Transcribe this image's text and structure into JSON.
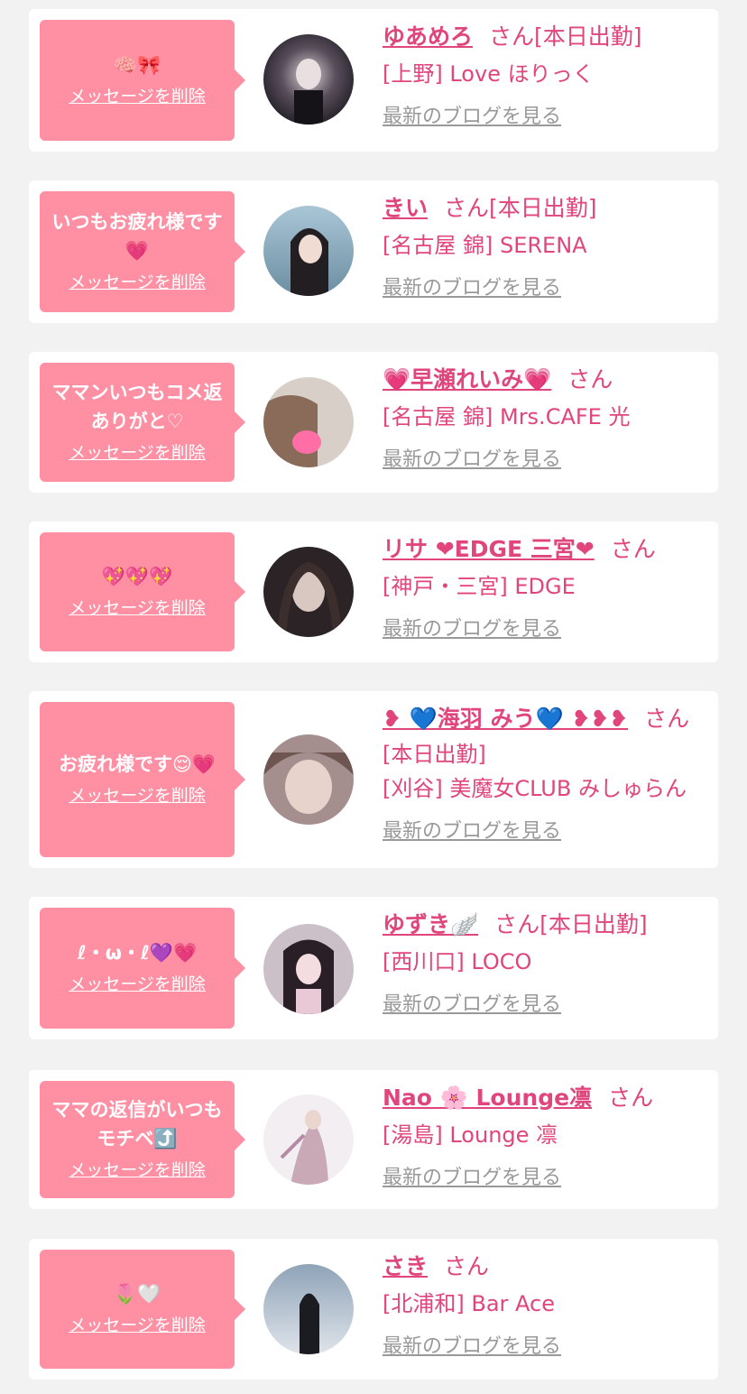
{
  "delete_label": "メッセージを削除",
  "blog_label": "最新のブログを見る",
  "colors": {
    "accent": "#e0457b",
    "bubble": "#ff8fa3",
    "background": "#f2f2f2",
    "link_gray": "#999999"
  },
  "entries": [
    {
      "message": "🧠🎀",
      "name": "ゆあめろ",
      "san": "さん",
      "status": "[本日出勤]",
      "shop": "[上野] Love ほりっく"
    },
    {
      "message": "いつもお疲れ様です💗",
      "name": "きい",
      "san": "さん",
      "status": "[本日出勤]",
      "shop": "[名古屋 錦] SERENA"
    },
    {
      "message": "ママンいつもコメ返ありがと♡",
      "name": "💗早瀬れいみ💗",
      "san": "さん",
      "status": "",
      "shop": "[名古屋 錦] Mrs.CAFE 光"
    },
    {
      "message": "💖💖💖",
      "name": "リサ ❤EDGE 三宮❤",
      "san": "さん",
      "status": "",
      "shop": "[神戸・三宮] EDGE"
    },
    {
      "message": "お疲れ様です😌💗",
      "name": "❥ 💙海羽 みう💙 ❥❥❥",
      "san": "さん",
      "status": "[本日出勤]",
      "shop": "[刈谷] 美魔女CLUB みしゅらん"
    },
    {
      "message": "ℓ・ω・ℓ💜💗",
      "name": "ゆずき🪽",
      "san": "さん",
      "status": "[本日出勤]",
      "shop": "[西川口] LOCO"
    },
    {
      "message": "ママの返信がいつもモチベ⤴️",
      "name": "Nao 🌸 Lounge凛",
      "san": "さん",
      "status": "",
      "shop": "[湯島] Lounge 凛"
    },
    {
      "message": "🌷🤍",
      "name": "さき",
      "san": "さん",
      "status": "",
      "shop": "[北浦和] Bar Ace"
    }
  ]
}
